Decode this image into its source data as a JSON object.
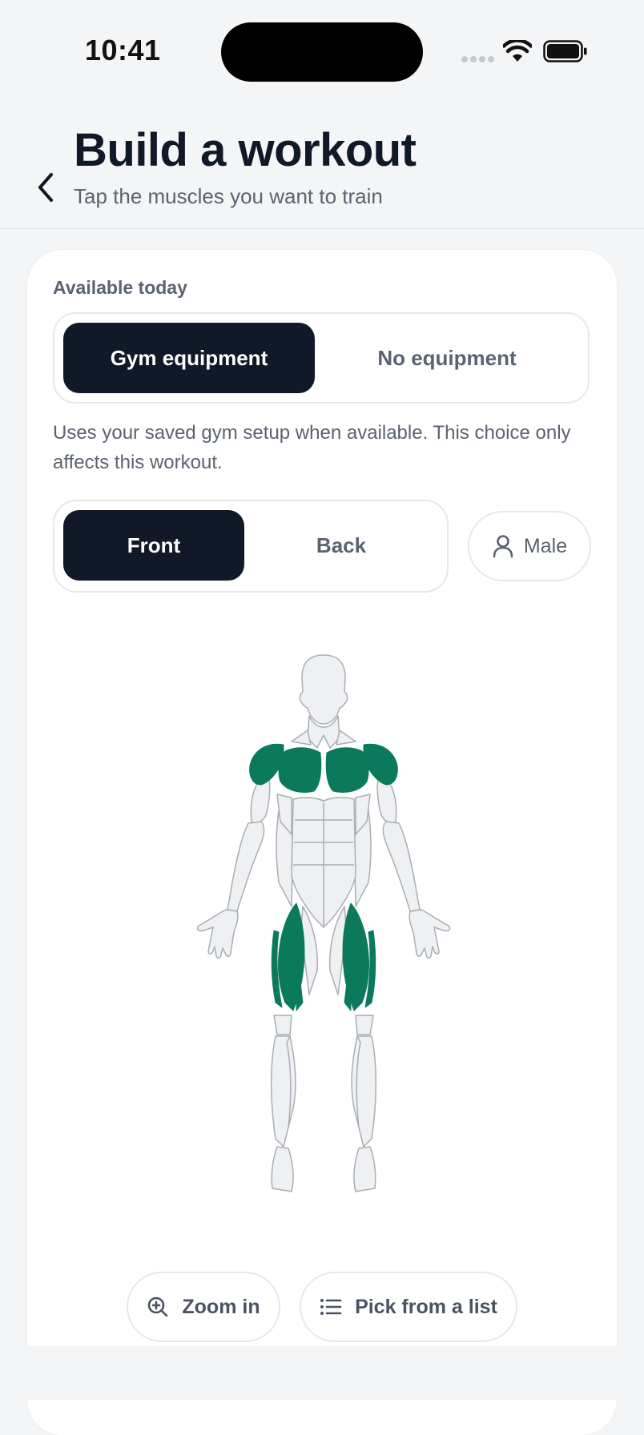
{
  "status": {
    "time": "10:41"
  },
  "header": {
    "title": "Build a workout",
    "subtitle": "Tap the muscles you want to train"
  },
  "equipment": {
    "label": "Available today",
    "options": [
      "Gym equipment",
      "No equipment"
    ],
    "selected": "Gym equipment",
    "description": "Uses your saved gym setup when available. This choice only affects this workout."
  },
  "view": {
    "options": [
      "Front",
      "Back"
    ],
    "selected": "Front"
  },
  "body_type": {
    "label": "Male",
    "icon": "person-icon"
  },
  "body_map": {
    "view": "front",
    "selected_muscles": [
      "shoulders",
      "chest",
      "quadriceps"
    ],
    "highlight_color": "#0b7a5c",
    "base_color": "#eff0f2",
    "outline_color": "#a9adb5"
  },
  "actions": {
    "zoom_label": "Zoom in",
    "zoom_icon": "zoom-in-icon",
    "list_label": "Pick from a list",
    "list_icon": "list-icon"
  },
  "colors": {
    "accent_dark": "#111827",
    "muted_text": "#5b6270",
    "background": "#f4f5f7"
  }
}
